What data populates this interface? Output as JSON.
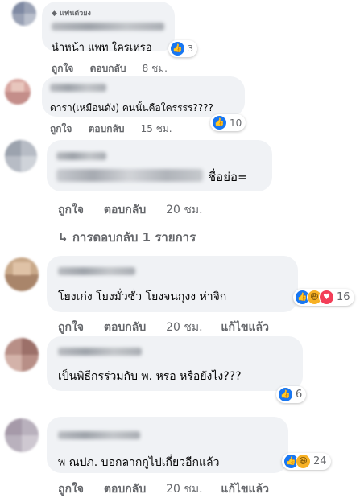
{
  "actions": {
    "like": "ถูกใจ",
    "reply": "ตอบกลับ",
    "edited": "แก้ไขแล้ว"
  },
  "comments": [
    {
      "badge": "แฟนตัวยง",
      "text": "นำหน้า แพท ใครเหรอ",
      "reactions": {
        "types": [
          "like"
        ],
        "count": "3"
      },
      "time": "8 ชม."
    },
    {
      "text": "ดารา(เหมือนดัง) คนนั้นคือใครรรร????",
      "reactions": {
        "types": [
          "like"
        ],
        "count": "10"
      },
      "time": "15 ชม."
    },
    {
      "text": "ชื่อย่อ=",
      "time": "20 ชม.",
      "replies_label": "การตอบกลับ 1 รายการ"
    },
    {
      "text": "โยงเก่ง โยงมั่วซั่ว โยงจนกุงง ห่าจิก",
      "reactions": {
        "types": [
          "like",
          "haha",
          "heart"
        ],
        "count": "16"
      },
      "time": "20 ชม."
    },
    {
      "text": "เป็นพิธีกรร่วมกับ พ. หรอ หรือยังไง???",
      "reactions": {
        "types": [
          "like"
        ],
        "count": "6"
      },
      "time": "20 ชม."
    },
    {
      "text": "พ ณปภ. บอกลากกูไปเกี่ยวอีกแล้ว",
      "reactions": {
        "types": [
          "like",
          "haha"
        ],
        "count": "24"
      },
      "time": "20 ชม."
    }
  ],
  "icons": {
    "like": "thumbs-up-icon",
    "haha": "laughing-face-icon",
    "heart": "heart-icon",
    "reply_arrow": "reply-arrow-icon",
    "badge": "diamond-icon"
  },
  "colors": {
    "like": "#1877f2",
    "haha": "#f7b125",
    "heart": "#f33e58",
    "bubble": "#f0f2f5",
    "meta": "#65676b"
  }
}
